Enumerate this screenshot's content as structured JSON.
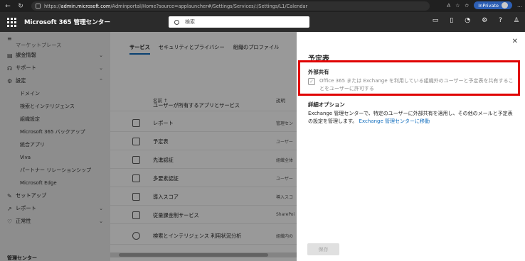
{
  "browser": {
    "url_prefix": "https://",
    "url_host": "admin.microsoft.com",
    "url_path": "/Adminportal/Home?source=applauncher#/Settings/Services/:/Settings/L1/Calendar",
    "inprivate_label": "InPrivate"
  },
  "header": {
    "app_title": "Microsoft 365 管理センター",
    "search_placeholder": "検索"
  },
  "leftnav": {
    "top_partial": "マーケットプレース",
    "items": [
      {
        "label": "課金情報",
        "icon": "billing-icon"
      },
      {
        "label": "サポート",
        "icon": "headset-icon"
      },
      {
        "label": "設定",
        "icon": "gear-icon"
      }
    ],
    "settings_sub": [
      "ドメイン",
      "検索とインテリジェンス",
      "組織設定",
      "Microsoft 365 バックアップ",
      "統合アプリ",
      "Viva",
      "パートナー リレーションシップ",
      "Microsoft Edge"
    ],
    "lower_items": [
      {
        "label": "セットアップ",
        "icon": "wrench-icon"
      },
      {
        "label": "レポート",
        "icon": "chart-icon"
      },
      {
        "label": "正常性",
        "icon": "heart-icon"
      }
    ],
    "admin_centers": "管理センター"
  },
  "main": {
    "tabs": [
      "サービス",
      "セキュリティとプライバシー",
      "組織のプロファイル"
    ],
    "col_name": "名前 ↑",
    "col_desc": "説明",
    "rows": [
      {
        "name": "ユーザーが所有するアプリとサービス",
        "desc": ""
      },
      {
        "name": "レポート",
        "desc": "管理セン"
      },
      {
        "name": "予定表",
        "desc": "ユーザー"
      },
      {
        "name": "先進認証",
        "desc": "組織全体"
      },
      {
        "name": "多要素認証",
        "desc": "ユーザー"
      },
      {
        "name": "導入スコア",
        "desc": "導入スコ"
      },
      {
        "name": "従量課金制サービス",
        "desc": "SharePoi"
      },
      {
        "name": "検索とインテリジェンス 利用状況分析",
        "desc": "組織内の"
      }
    ]
  },
  "panel": {
    "title": "予定表",
    "external_sharing_title": "外部共有",
    "checkbox_label": "Office 365 または Exchange を利用している組織外のユーザーと予定表を共有することをユーザーに許可する",
    "checkbox_checked": true,
    "detail_title": "詳細オプション",
    "detail_text": "Exchange 管理センターで、特定のユーザーに外部共有を適用し、その他のメールと予定表の設定を管理します。",
    "detail_link": "Exchange 管理センターに移動",
    "save_label": "保存"
  },
  "colors": {
    "accent": "#0f6cbd",
    "highlight_border": "#e00000",
    "header_bg": "#2b2b2b"
  }
}
